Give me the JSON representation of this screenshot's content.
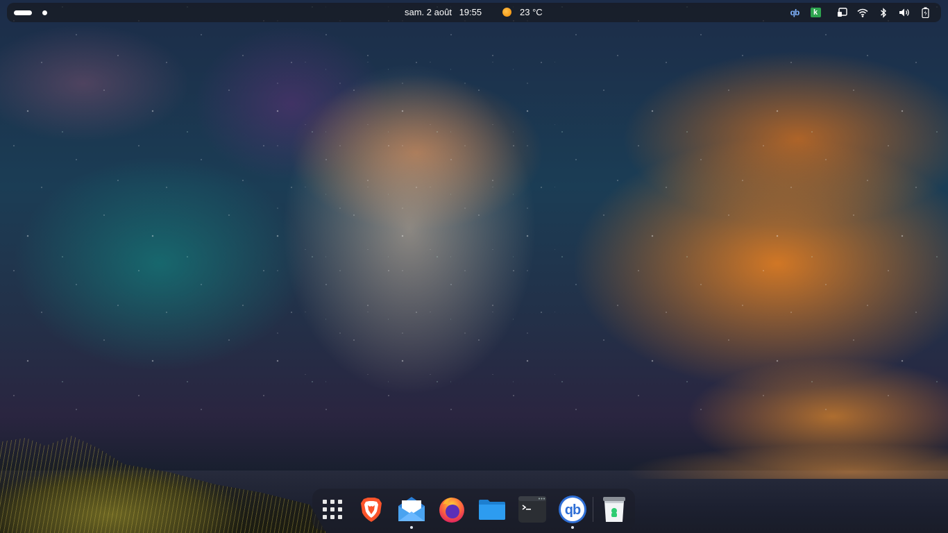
{
  "topbar": {
    "date": "sam. 2 août",
    "time": "19:55",
    "temperature": "23 °C",
    "weather_icon": "sun-icon",
    "tray_icons": [
      "qbittorrent-tray-icon",
      "kde-connect-tray-icon",
      "screen-cast-icon",
      "wifi-icon",
      "bluetooth-icon",
      "volume-icon",
      "battery-icon"
    ],
    "qb_label": "qb",
    "k_label": "k"
  },
  "dock": {
    "items": [
      {
        "name": "app-grid-button",
        "icon": "grid-icon",
        "running": false
      },
      {
        "name": "brave-browser",
        "icon": "brave-lion-icon",
        "running": false
      },
      {
        "name": "mail-client",
        "icon": "envelope-icon",
        "running": true
      },
      {
        "name": "firefox",
        "icon": "firefox-icon",
        "running": false
      },
      {
        "name": "files",
        "icon": "folder-icon",
        "running": false
      },
      {
        "name": "terminal",
        "icon": "terminal-icon",
        "running": false
      },
      {
        "name": "qbittorrent",
        "icon": "qbittorrent-icon",
        "running": true
      },
      {
        "name": "trash",
        "icon": "trash-icon",
        "running": false
      }
    ],
    "qb_label": "qb"
  },
  "colors": {
    "brave": "#fb542b",
    "mail": "#3a8ee6",
    "firefox": "#ff7139",
    "folder": "#2d9cf0",
    "terminal": "#2b2e33",
    "qbittorrent": "#2f6fd6",
    "trash": "#2ecc71"
  }
}
